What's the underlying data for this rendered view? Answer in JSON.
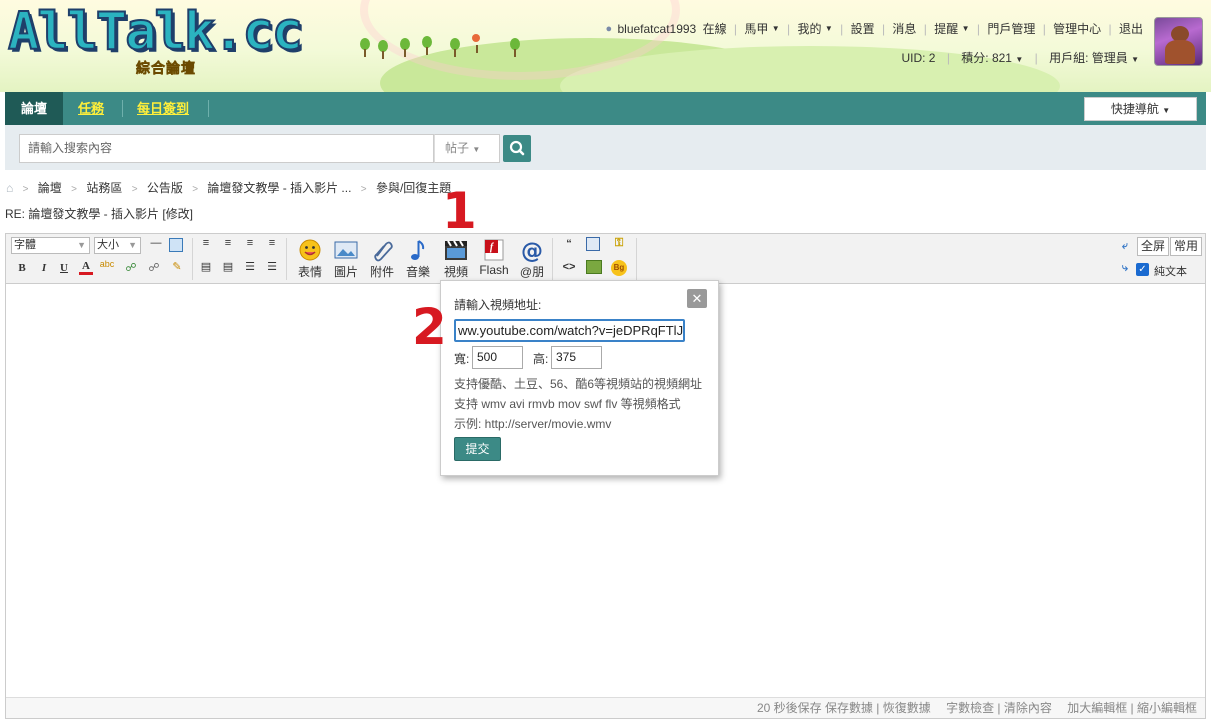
{
  "header": {
    "logo_text": "AllTalk.cc",
    "logo_sub": "綜合論壇",
    "username": "bluefatcat1993",
    "online_status": "在線",
    "nav_items": [
      "馬甲",
      "我的",
      "設置",
      "消息",
      "提醒",
      "門戶管理",
      "管理中心",
      "退出"
    ],
    "uid": "UID: 2",
    "points": "積分: 821",
    "usergroup": "用戶組: 管理員"
  },
  "navbar": {
    "tabs": [
      "論壇",
      "任務",
      "每日簽到"
    ],
    "quick_nav": "快捷導航"
  },
  "search": {
    "placeholder": "請輸入搜索內容",
    "type": "帖子"
  },
  "breadcrumb": [
    "論壇",
    "站務區",
    "公告版",
    "論壇發文教學 - 插入影片 ...",
    "參與/回復主題"
  ],
  "reply_title": "RE: 論壇發文教學 - 插入影片 [修改]",
  "editor": {
    "font_select": "字體",
    "size_select": "大小",
    "big_buttons": [
      "表情",
      "圖片",
      "附件",
      "音樂",
      "視頻",
      "Flash",
      "@朋"
    ],
    "fullscreen": "全屏",
    "common": "常用",
    "plain_text": "純文本",
    "status": "20 秒後保存 保存數據 | 恢復數據　 字數檢查 | 清除內容　 加大編輯框 | 縮小編輯框"
  },
  "popup": {
    "title": "請輸入視頻地址:",
    "url_value": "ww.youtube.com/watch?v=jeDPRqFTlJs",
    "width_label": "寬:",
    "width_value": "500",
    "height_label": "高:",
    "height_value": "375",
    "help1": "支持優酷、土豆、56、酷6等視頻站的視頻網址",
    "help2": "支持 wmv avi rmvb mov swf flv 等視頻格式",
    "help3": "示例: http://server/movie.wmv",
    "submit": "提交"
  },
  "markers": [
    "1",
    "2"
  ],
  "colors": {
    "nav_bg": "#3c8a86",
    "nav_active": "#1f5a56",
    "nav_link": "#ffef3a",
    "marker": "#d71921"
  }
}
